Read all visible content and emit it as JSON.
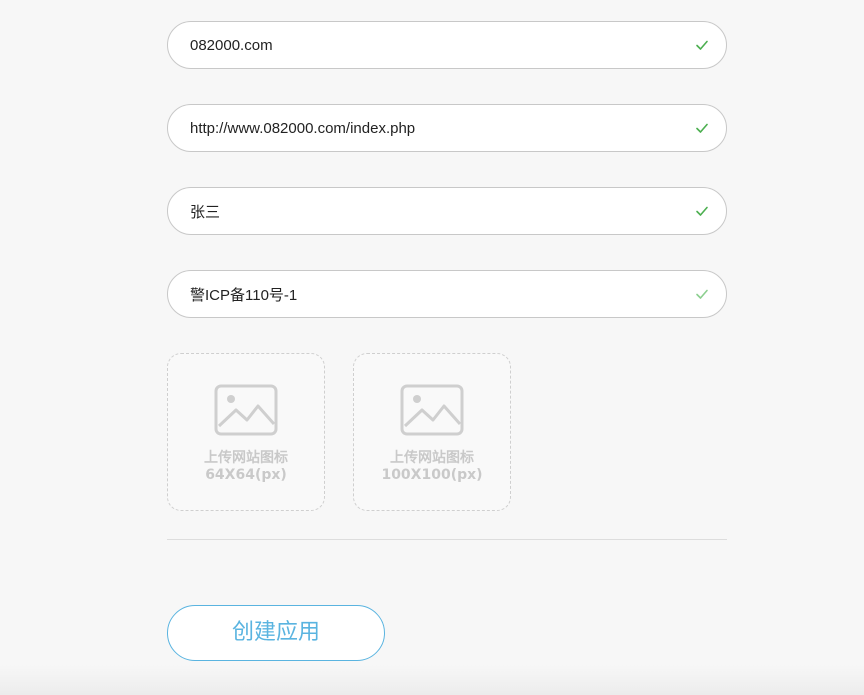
{
  "form": {
    "fields": [
      {
        "value": "082000.com",
        "valid": true
      },
      {
        "value": "http://www.082000.com/index.php",
        "valid": true
      },
      {
        "value": "张三",
        "valid": true
      },
      {
        "value": "警ICP备110号-1",
        "valid": true
      }
    ],
    "uploads": [
      {
        "label": "上传网站图标",
        "size": "64X64(px)"
      },
      {
        "label": "上传网站图标",
        "size": "100X100(px)"
      }
    ],
    "submit_label": "创建应用"
  },
  "colors": {
    "check": "#4caf50",
    "accent": "#5ab4e0",
    "placeholder_gray": "#c9c9c9",
    "border": "#c8c8c8"
  },
  "icons": {
    "valid": "check-icon",
    "upload": "image-placeholder-icon"
  }
}
